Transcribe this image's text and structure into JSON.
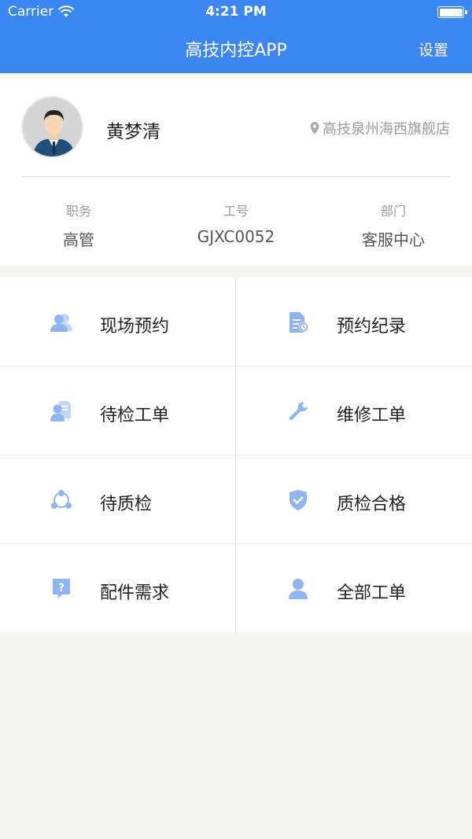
{
  "status_bar": {
    "carrier": "Carrier",
    "time": "4:21 PM"
  },
  "nav": {
    "title": "高技内控APP",
    "settings": "设置"
  },
  "profile": {
    "name": "黄梦清",
    "location": "高技泉州海西旗舰店",
    "info": [
      {
        "label": "职务",
        "value": "高管"
      },
      {
        "label": "工号",
        "value": "GJXC0052"
      },
      {
        "label": "部门",
        "value": "客服中心"
      }
    ]
  },
  "menu": [
    {
      "label": "现场预约",
      "icon": "users-icon"
    },
    {
      "label": "预约纪录",
      "icon": "document-icon"
    },
    {
      "label": "待检工单",
      "icon": "inspector-icon"
    },
    {
      "label": "维修工单",
      "icon": "wrench-icon"
    },
    {
      "label": "待质检",
      "icon": "network-icon"
    },
    {
      "label": "质检合格",
      "icon": "shield-check-icon"
    },
    {
      "label": "配件需求",
      "icon": "question-icon"
    },
    {
      "label": "全部工单",
      "icon": "user-icon"
    }
  ],
  "colors": {
    "primary": "#3b86f0",
    "icon": "#8fb4ef",
    "background": "#f4f3f0"
  }
}
